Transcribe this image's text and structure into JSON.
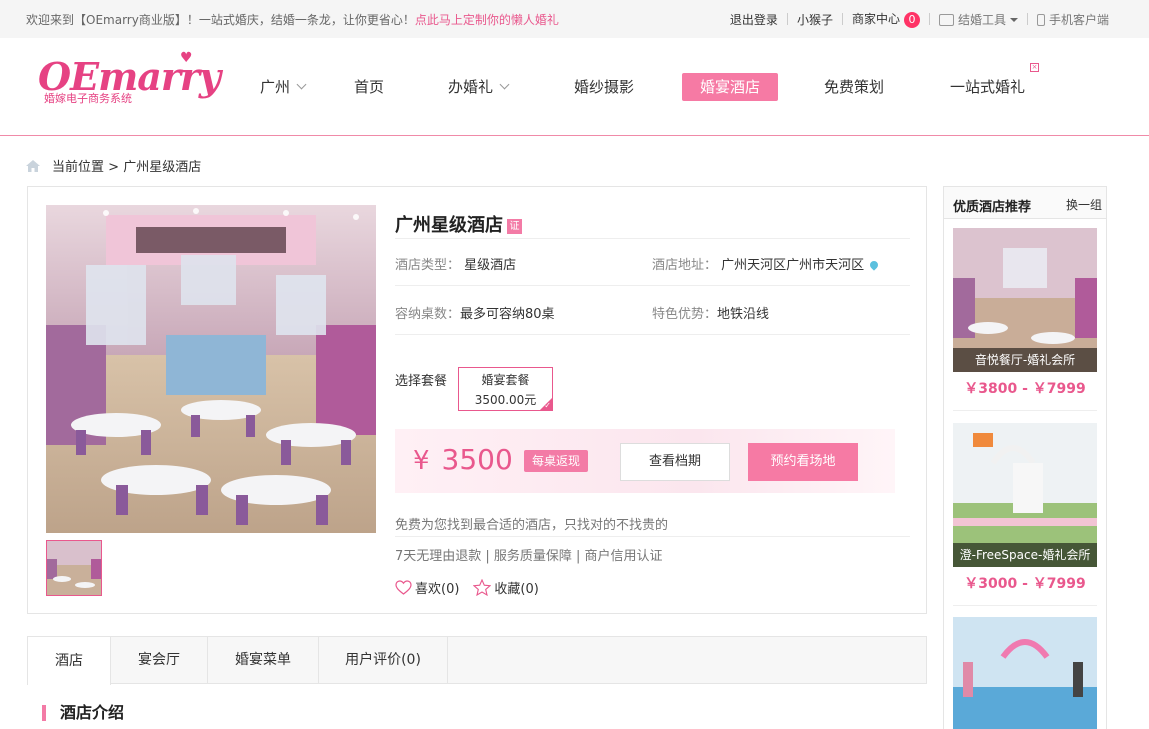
{
  "topbar": {
    "welcome": "欢迎来到【OEmarry商业版】！一站式婚庆，结婚一条龙，让你更省心！",
    "promo_link": "点此马上定制你的懒人婚礼",
    "logout": "退出登录",
    "username": "小猴子",
    "merchant_center": "商家中心",
    "merchant_count": "0",
    "wedding_tools": "结婚工具",
    "mobile_client": "手机客户端"
  },
  "logo": {
    "brand": "OEmarry",
    "subtitle": "婚嫁电子商务系统"
  },
  "nav": {
    "city": "广州",
    "items": [
      "首页",
      "办婚礼",
      "婚纱摄影",
      "婚宴酒店",
      "免费策划",
      "一站式婚礼"
    ],
    "active_index": 3
  },
  "breadcrumb": {
    "prefix": "当前位置",
    "sep": ">",
    "current": "广州星级酒店"
  },
  "hotel": {
    "name": "广州星级酒店",
    "cert_badge": "证",
    "type_label": "酒店类型：",
    "type_value": "星级酒店",
    "address_label": "酒店地址：",
    "address_value": "广州天河区广州市天河区",
    "capacity_label": "容纳桌数：",
    "capacity_value": "最多可容纳80桌",
    "feature_label": "特色优势：",
    "feature_value": "地铁沿线",
    "package_label": "选择套餐",
    "package_name": "婚宴套餐",
    "package_price": "3500.00元",
    "price_symbol": "¥",
    "price": "3500",
    "rebate": "每桌返现",
    "check_schedule": "查看档期",
    "book_visit": "预约看场地",
    "slogan": "免费为您找到最合适的酒店，只找对的不找贵的",
    "guarantee": "7天无理由退款 | 服务质量保障 | 商户信用认证",
    "like": "喜欢(0)",
    "favorite": "收藏(0)"
  },
  "tabs": [
    "酒店",
    "宴会厅",
    "婚宴菜单",
    "用户评价(0)"
  ],
  "section_title": "酒店介绍",
  "sidebar": {
    "title": "优质酒店推荐",
    "switch": "换一组",
    "items": [
      {
        "name": "音悦餐厅-婚礼会所",
        "price": "￥3800 - ￥7999"
      },
      {
        "name": "澄-FreeSpace-婚礼会所",
        "price": "￥3000 - ￥7999"
      },
      {
        "name": "",
        "price": ""
      }
    ]
  },
  "colors": {
    "accent": "#f67aa4",
    "brand": "#e64283",
    "price": "#e9588d"
  }
}
